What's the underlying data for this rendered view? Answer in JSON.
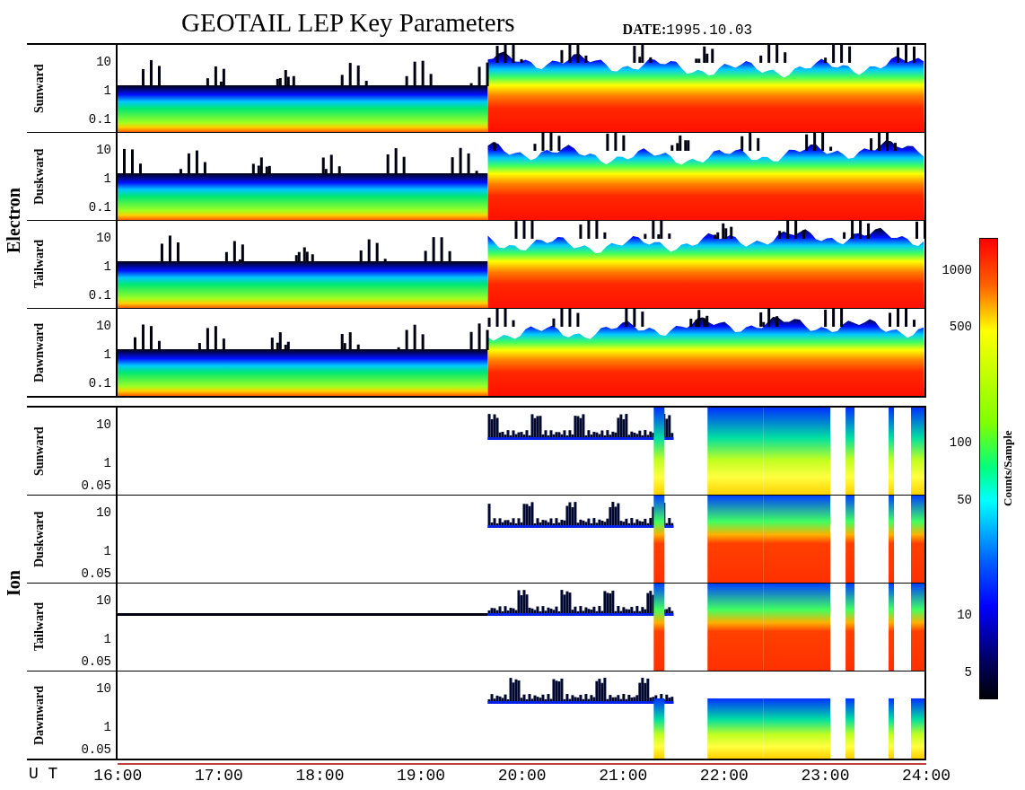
{
  "title": "GEOTAIL LEP Key Parameters",
  "date": {
    "label": "DATE:",
    "value": "1995.10.03"
  },
  "groups": [
    {
      "name": "Electron",
      "kind": "electron",
      "panels": [
        {
          "label": "Sunward",
          "ticks": [
            "10",
            "1",
            "0.1"
          ]
        },
        {
          "label": "Duskward",
          "ticks": [
            "10",
            "1",
            "0.1"
          ]
        },
        {
          "label": "Tailward",
          "ticks": [
            "10",
            "1",
            "0.1"
          ]
        },
        {
          "label": "Dawnward",
          "ticks": [
            "10",
            "1",
            "0.1"
          ]
        }
      ]
    },
    {
      "name": "Ion",
      "kind": "ion",
      "panels": [
        {
          "label": "Sunward",
          "ticks": [
            "10",
            "1",
            "0.05"
          ]
        },
        {
          "label": "Duskward",
          "ticks": [
            "10",
            "1",
            "0.05"
          ]
        },
        {
          "label": "Tailward",
          "ticks": [
            "10",
            "1",
            "0.05"
          ]
        },
        {
          "label": "Dawnward",
          "ticks": [
            "10",
            "1",
            "0.05"
          ]
        }
      ]
    }
  ],
  "time_axis": {
    "label": "U T",
    "ticks": [
      "16:00",
      "17:00",
      "18:00",
      "19:00",
      "20:00",
      "21:00",
      "22:00",
      "23:00",
      "24:00"
    ]
  },
  "colorbar": {
    "label": "Counts/Sample",
    "ticks": [
      "1000",
      "500",
      "100",
      "50",
      "10",
      "5"
    ]
  }
}
